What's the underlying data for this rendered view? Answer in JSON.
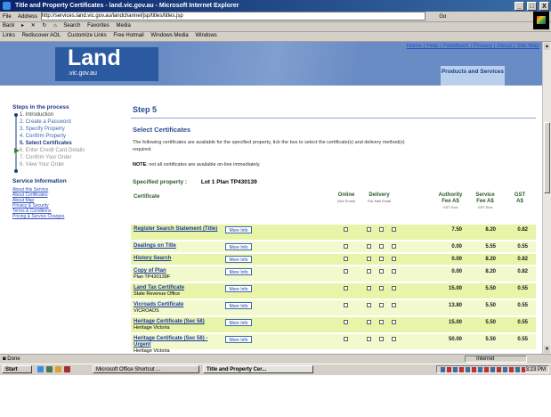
{
  "window": {
    "title": "Title and Property Certificates - land.vic.gov.au - Microsoft Internet Explorer",
    "controls": [
      "_",
      "□",
      "X"
    ]
  },
  "addressbar": {
    "menu": "File",
    "label": "Address",
    "url": "http://services.land.vic.gov.au/landchannel/jsp/titles/titles.jsp",
    "go": "Go"
  },
  "toolbar": {
    "back": "Back",
    "search": "Search",
    "favorites": "Favorites",
    "media": "Media"
  },
  "linksbar": {
    "label": "Links",
    "items": [
      "Rediscover AOL",
      "Customize Links",
      "Free Hotmail",
      "Windows Media",
      "Windows"
    ]
  },
  "header": {
    "logo_main": "Land",
    "logo_sub": ".vic.gov.au",
    "toplinks": "Home | Help | Feedback | Privacy | About | Site Map",
    "products_tab": "Products and Services"
  },
  "sidebar": {
    "steps_title": "Steps in the process",
    "steps": [
      "1. Introduction",
      "2. Create a Password",
      "3. Specify Property",
      "4. Confirm Property",
      "5. Select Certificates",
      "6. Enter Credit Card Details",
      "7. Confirm Your Order",
      "8. View Your Order"
    ],
    "service_title": "Service Information",
    "service_links": [
      "About this Service",
      "About Certificates",
      "About Map",
      "Privacy & Security",
      "Terms & Conditions",
      "Pricing & Service Charges"
    ]
  },
  "main": {
    "step_heading": "Step 5",
    "section_heading": "Select Certificates",
    "intro_line1": "The following certificates are available for the specified property, tick the box to select the certificate(s) and delivery method(s)",
    "intro_line2": "required.",
    "note_label": "NOTE",
    "note_text": ": not all certificates are available on-line immediately.",
    "property_label": "Specified property :",
    "property_value": "Lot 1 Plan TP430139"
  },
  "table": {
    "col_certificate": "Certificate",
    "col_online": "Online",
    "col_online_sub": "(Not Email)",
    "col_delivery": "Delivery",
    "col_delivery_sub": "Fax Mail Email",
    "col_authority": "Authority Fee A$",
    "col_authority_sub": "GST Excl",
    "col_service": "Service Fee A$",
    "col_service_sub": "GST Excl",
    "col_gst": "GST A$",
    "more_info": "More Info",
    "rows": [
      {
        "name": "Register Search Statement (Title)",
        "sub": "",
        "authority": "7.50",
        "service": "8.20",
        "gst": "0.82"
      },
      {
        "name": "Dealings on Title",
        "sub": "",
        "authority": "0.00",
        "service": "5.55",
        "gst": "0.55"
      },
      {
        "name": "History Search",
        "sub": "",
        "authority": "0.00",
        "service": "8.20",
        "gst": "0.82"
      },
      {
        "name": "Copy of Plan",
        "sub": "Plan TP430139F",
        "authority": "0.00",
        "service": "8.20",
        "gst": "0.82"
      },
      {
        "name": "Land Tax Certificate",
        "sub": "State Revenue Office",
        "authority": "15.00",
        "service": "5.50",
        "gst": "0.55"
      },
      {
        "name": "Vicroads Certificate",
        "sub": "VICROADS",
        "authority": "13.80",
        "service": "5.50",
        "gst": "0.55"
      },
      {
        "name": "Heritage Certificate (Sec 58)",
        "sub": "Heritage Victoria",
        "authority": "15.00",
        "service": "5.50",
        "gst": "0.55"
      },
      {
        "name": "Heritage Certificate (Sec 58) - Urgent",
        "sub": "Heritage Victoria",
        "authority": "50.00",
        "service": "5.50",
        "gst": "0.55"
      }
    ]
  },
  "statusbar": {
    "left": "Done",
    "zone": "Internet"
  },
  "taskbar": {
    "start": "Start",
    "task1": "Microsoft Office Shortcut ...",
    "task2": "Title and Property Cer...",
    "clock": "3:23 PM"
  }
}
